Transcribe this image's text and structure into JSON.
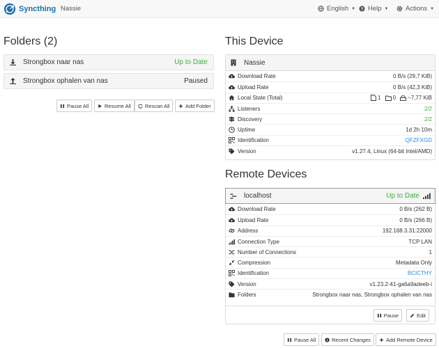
{
  "navbar": {
    "app_name": "Syncthing",
    "device_name": "Nassie",
    "language_label": "English",
    "help_label": "Help",
    "actions_label": "Actions"
  },
  "folders": {
    "title": "Folders (2)",
    "items": [
      {
        "name": "Strongbox naar nas",
        "status": "Up to Date"
      },
      {
        "name": "Strongbox ophalen van nas",
        "status": "Paused"
      }
    ],
    "buttons": {
      "pause_all": "Pause All",
      "resume_all": "Resume All",
      "rescan_all": "Rescan All",
      "add_folder": "Add Folder"
    }
  },
  "this_device": {
    "title": "This Device",
    "name": "Nassie",
    "rows": {
      "download_label": "Download Rate",
      "download_value": "0 B/s (29,7 KiB)",
      "upload_label": "Upload Rate",
      "upload_value": "0 B/s (42,3 KiB)",
      "local_state_label": "Local State (Total)",
      "local_files": "1",
      "local_dirs": "0",
      "local_size": "~7,77 KiB",
      "listeners_label": "Listeners",
      "listeners_value": "2/2",
      "discovery_label": "Discovery",
      "discovery_value": "2/2",
      "uptime_label": "Uptime",
      "uptime_value": "1d 2h 10m",
      "identification_label": "Identification",
      "identification_value": "QFZFXGD",
      "version_label": "Version",
      "version_value": "v1.27.4, Linux (64-bit Intel/AMD)"
    }
  },
  "remote_devices": {
    "title": "Remote Devices",
    "device": {
      "name": "localhost",
      "status": "Up to Date",
      "rows": {
        "download_label": "Download Rate",
        "download_value": "0 B/s (262 B)",
        "upload_label": "Upload Rate",
        "upload_value": "0 B/s (266 B)",
        "address_label": "Address",
        "address_value": "192.168.3.31:22000",
        "conn_type_label": "Connection Type",
        "conn_type_value": "TCP LAN",
        "num_conn_label": "Number of Connections",
        "num_conn_value": "1",
        "compression_label": "Compression",
        "compression_value": "Metadata Only",
        "identification_label": "Identification",
        "identification_value": "BCICTHY",
        "version_label": "Version",
        "version_value": "v1.23.2-41-ga6a9adeeb-i",
        "folders_label": "Folders",
        "folders_value": "Strongbox naar nas, Strongbox ophalen van nas"
      },
      "pause_label": "Pause",
      "edit_label": "Edit"
    },
    "buttons": {
      "pause_all": "Pause All",
      "recent_changes": "Recent Changes",
      "add_remote": "Add Remote Device"
    }
  },
  "colors": {
    "brand": "#1e6fa8",
    "ok": "#3cae3c",
    "link": "#2a8bd8"
  }
}
